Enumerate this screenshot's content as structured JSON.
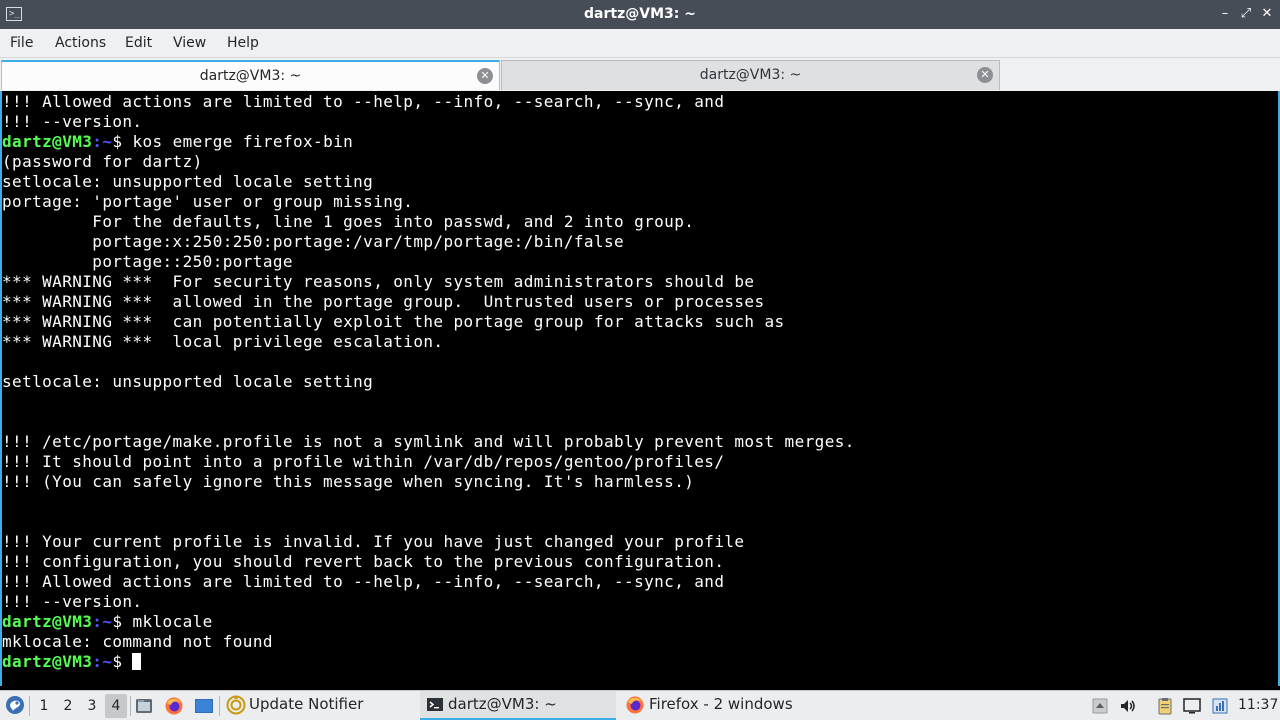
{
  "window": {
    "title": "dartz@VM3: ~",
    "controls": {
      "minimize": "–",
      "maximize": "⤢",
      "close": "✕"
    }
  },
  "menu": [
    "File",
    "Actions",
    "Edit",
    "View",
    "Help"
  ],
  "tabs": [
    {
      "label": "dartz@VM3: ~",
      "active": true
    },
    {
      "label": "dartz@VM3: ~",
      "active": false
    }
  ],
  "terminal": {
    "prompt_user": "dartz@VM3",
    "prompt_path": ":~",
    "prompt_symbol": "$ ",
    "lines": [
      {
        "text": "!!! Allowed actions are limited to --help, --info, --search, --sync, and"
      },
      {
        "text": "!!! --version."
      },
      {
        "prompt": true,
        "text": "kos emerge firefox-bin"
      },
      {
        "text": "(password for dartz)"
      },
      {
        "text": "setlocale: unsupported locale setting"
      },
      {
        "text": "portage: 'portage' user or group missing."
      },
      {
        "text": "         For the defaults, line 1 goes into passwd, and 2 into group."
      },
      {
        "text": "         portage:x:250:250:portage:/var/tmp/portage:/bin/false"
      },
      {
        "text": "         portage::250:portage"
      },
      {
        "text": "*** WARNING ***  For security reasons, only system administrators should be"
      },
      {
        "text": "*** WARNING ***  allowed in the portage group.  Untrusted users or processes"
      },
      {
        "text": "*** WARNING ***  can potentially exploit the portage group for attacks such as"
      },
      {
        "text": "*** WARNING ***  local privilege escalation."
      },
      {
        "text": ""
      },
      {
        "text": "setlocale: unsupported locale setting"
      },
      {
        "text": ""
      },
      {
        "text": ""
      },
      {
        "text": "!!! /etc/portage/make.profile is not a symlink and will probably prevent most merges."
      },
      {
        "text": "!!! It should point into a profile within /var/db/repos/gentoo/profiles/"
      },
      {
        "text": "!!! (You can safely ignore this message when syncing. It's harmless.)"
      },
      {
        "text": ""
      },
      {
        "text": ""
      },
      {
        "text": "!!! Your current profile is invalid. If you have just changed your profile"
      },
      {
        "text": "!!! configuration, you should revert back to the previous configuration."
      },
      {
        "text": "!!! Allowed actions are limited to --help, --info, --search, --sync, and"
      },
      {
        "text": "!!! --version."
      },
      {
        "prompt": true,
        "text": "mklocale"
      },
      {
        "text": "mklocale: command not found"
      },
      {
        "prompt": true,
        "text": "",
        "cursor": true
      }
    ]
  },
  "taskbar": {
    "start_icon": "gentoo-icon",
    "workspaces": [
      "1",
      "2",
      "3",
      "4"
    ],
    "active_workspace": "4",
    "quicklaunch": [
      "file-manager-icon",
      "firefox-icon",
      "desktop-icon"
    ],
    "tasks": [
      {
        "label": "Update Notifier",
        "icon": "update-notifier-icon",
        "active": false
      },
      {
        "label": "dartz@VM3: ~",
        "icon": "terminal-icon",
        "active": true
      },
      {
        "label": "Firefox - 2 windows",
        "icon": "firefox-icon",
        "active": false
      }
    ],
    "tray": [
      "tray-arrow-icon",
      "volume-icon",
      "clipboard-icon",
      "screen-icon",
      "network-icon"
    ],
    "clock": "11:37"
  },
  "colors": {
    "accent": "#3daee9",
    "prompt_user": "#54ff54",
    "prompt_path": "#5454ff",
    "titlebar": "#474d57"
  }
}
